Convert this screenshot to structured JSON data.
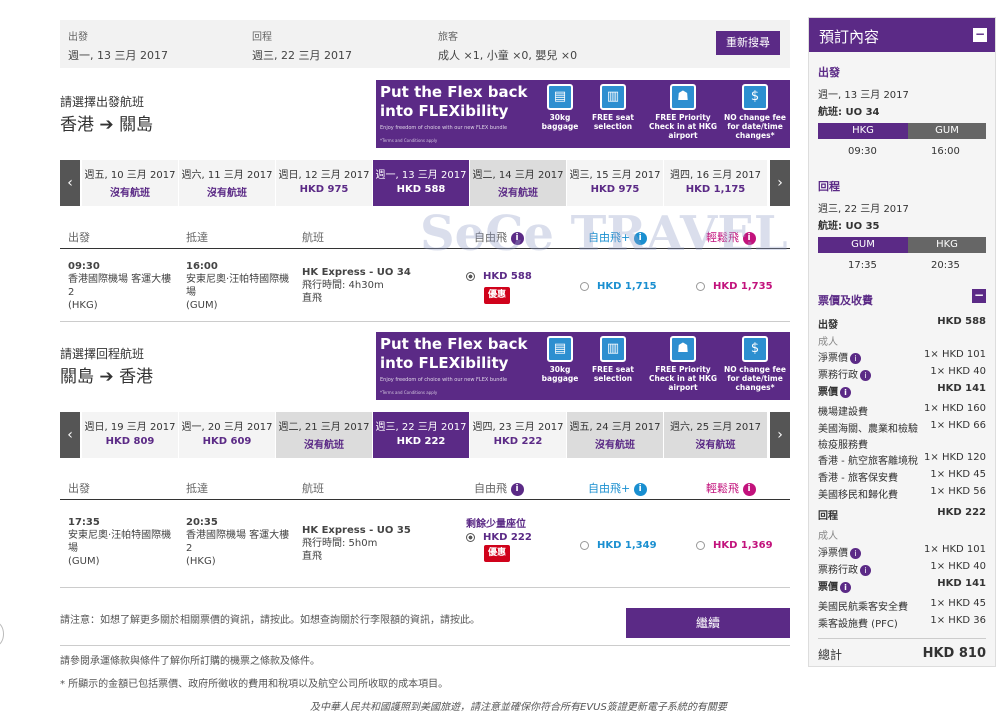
{
  "search": {
    "depart_label": "出發",
    "depart_value": "週一, 13 三月 2017",
    "return_label": "回程",
    "return_value": "週三, 22 三月 2017",
    "pax_label": "旅客",
    "pax_value": "成人 ×1, 小童 ×0, 嬰兒 ×0",
    "research_button": "重新搜尋"
  },
  "banner": {
    "headline": "Put the Flex back into FLEXibility",
    "tagline": "Enjoy freedom of choice with our new FLEX bundle",
    "terms": "*Terms and Conditions apply",
    "features": [
      {
        "icon": "baggage-icon",
        "label": "30kg baggage"
      },
      {
        "icon": "seat-icon",
        "label": "FREE seat selection"
      },
      {
        "icon": "checkin-icon",
        "label": "FREE Priority Check in at HKG airport"
      },
      {
        "icon": "no-fee-icon",
        "label": "NO change fee for date/time changes*"
      }
    ]
  },
  "outbound": {
    "title": "請選擇出發航班",
    "origin": "香港",
    "destination": "關島",
    "dates": [
      {
        "date": "週五, 10 三月 2017",
        "price": "沒有航班"
      },
      {
        "date": "週六, 11 三月 2017",
        "price": "沒有航班"
      },
      {
        "date": "週日, 12 三月 2017",
        "price": "HKD 975"
      },
      {
        "date": "週一, 13 三月 2017",
        "price": "HKD 588"
      },
      {
        "date": "週二, 14 三月 2017",
        "price": "沒有航班"
      },
      {
        "date": "週三, 15 三月 2017",
        "price": "HKD 975"
      },
      {
        "date": "週四, 16 三月 2017",
        "price": "HKD 1,175"
      }
    ],
    "flight": {
      "dep_time": "09:30",
      "dep_airport": "香港國際機場 客運大樓 2",
      "dep_code": "(HKG)",
      "arr_time": "16:00",
      "arr_airport": "安東尼奧·汪帕特國際機場",
      "arr_code": "(GUM)",
      "flight_no": "HK Express - UO 34",
      "duration": "飛行時間: 4h30m",
      "stops": "直飛",
      "fare_fun": "HKD 588",
      "fare_fun_plus": "HKD 1,715",
      "fare_flex": "HKD 1,735",
      "badge": "優惠",
      "seats_left": ""
    }
  },
  "inbound": {
    "title": "請選擇回程航班",
    "origin": "關島",
    "destination": "香港",
    "dates": [
      {
        "date": "週日, 19 三月 2017",
        "price": "HKD 809"
      },
      {
        "date": "週一, 20 三月 2017",
        "price": "HKD 609"
      },
      {
        "date": "週二, 21 三月 2017",
        "price": "沒有航班"
      },
      {
        "date": "週三, 22 三月 2017",
        "price": "HKD 222"
      },
      {
        "date": "週四, 23 三月 2017",
        "price": "HKD 222"
      },
      {
        "date": "週五, 24 三月 2017",
        "price": "沒有航班"
      },
      {
        "date": "週六, 25 三月 2017",
        "price": "沒有航班"
      }
    ],
    "flight": {
      "dep_time": "17:35",
      "dep_airport": "安東尼奧·汪帕特國際機場",
      "dep_code": "(GUM)",
      "arr_time": "20:35",
      "arr_airport": "香港國際機場 客運大樓 2",
      "arr_code": "(HKG)",
      "flight_no": "HK Express - UO 35",
      "duration": "飛行時間: 5h0m",
      "stops": "直飛",
      "fare_fun": "HKD 222",
      "fare_fun_plus": "HKD 1,349",
      "fare_flex": "HKD 1,369",
      "badge": "優惠",
      "seats_left": "剩餘少量座位"
    }
  },
  "table_headers": {
    "depart": "出發",
    "arrive": "抵達",
    "flight": "航班",
    "fun": "自由飛",
    "fun_plus": "自由飛+",
    "flex": "輕鬆飛"
  },
  "notes": {
    "line1_a": "請注意：如想了解更多關於相關票價的資訊，請按此。如想查詢關於行李限額的資訊，請按此。",
    "line2": "請參閱承運條款與條件了解你所訂購的機票之條款及條件。",
    "line3": "* 所顯示的金額已包括票價、政府所徵收的費用和稅項以及航空公司所收取的成本項目。",
    "line4": "及中華人民共和國護照到美國旅遊，請注意並確保你符合所有EVUS簽證更新電子系統的有關要",
    "continue_button": "繼續"
  },
  "sidebar": {
    "title": "預訂內容",
    "out_label": "出發",
    "out_date": "週一, 13 三月 2017",
    "out_flight": "航班: UO 34",
    "out_from": "HKG",
    "out_to": "GUM",
    "out_dep": "09:30",
    "out_arr": "16:00",
    "ret_label": "回程",
    "ret_date": "週三, 22 三月 2017",
    "ret_flight": "航班: UO 35",
    "ret_from": "GUM",
    "ret_to": "HKG",
    "ret_dep": "17:35",
    "ret_arr": "20:35",
    "fare_title": "票價及收費",
    "fare_rows": [
      {
        "label": "出發",
        "value": "HKD 588",
        "style": "bold"
      },
      {
        "label": "成人",
        "value": "",
        "style": "grey"
      },
      {
        "label": "淨票價",
        "value": "1× HKD 101",
        "style": "",
        "info": true
      },
      {
        "label": "票務行政",
        "value": "1× HKD 40",
        "style": "",
        "info": true
      },
      {
        "label": "票價",
        "value": "HKD 141",
        "style": "bold",
        "info": true
      },
      {
        "label": "機場建設費",
        "value": "1× HKD 160",
        "style": ""
      },
      {
        "label": "美國海關、農業和檢驗",
        "value": "1× HKD 66",
        "style": ""
      },
      {
        "label": "檢疫服務費",
        "value": "",
        "style": ""
      },
      {
        "label": "香港 - 航空旅客離境稅",
        "value": "1× HKD 120",
        "style": ""
      },
      {
        "label": "香港 - 旅客保安費",
        "value": "1× HKD 45",
        "style": ""
      },
      {
        "label": "美國移民和歸化費",
        "value": "1× HKD 56",
        "style": ""
      },
      {
        "label": "回程",
        "value": "HKD 222",
        "style": "bold"
      },
      {
        "label": "成人",
        "value": "",
        "style": "grey"
      },
      {
        "label": "淨票價",
        "value": "1× HKD 101",
        "style": "",
        "info": true
      },
      {
        "label": "票務行政",
        "value": "1× HKD 40",
        "style": "",
        "info": true
      },
      {
        "label": "票價",
        "value": "HKD 141",
        "style": "bold",
        "info": true
      },
      {
        "label": "美國民航乘客安全費",
        "value": "1× HKD 45",
        "style": ""
      },
      {
        "label": "乘客設施費 (PFC)",
        "value": "1× HKD 36",
        "style": ""
      }
    ],
    "total_label": "總計",
    "total_value": "HKD 810"
  },
  "watermark": "SeCe TRAVEL",
  "colors": {
    "brand": "#5b2a86",
    "fun_plus": "#1a8fd0",
    "flex": "#c2127c",
    "promo": "#d0021b"
  }
}
